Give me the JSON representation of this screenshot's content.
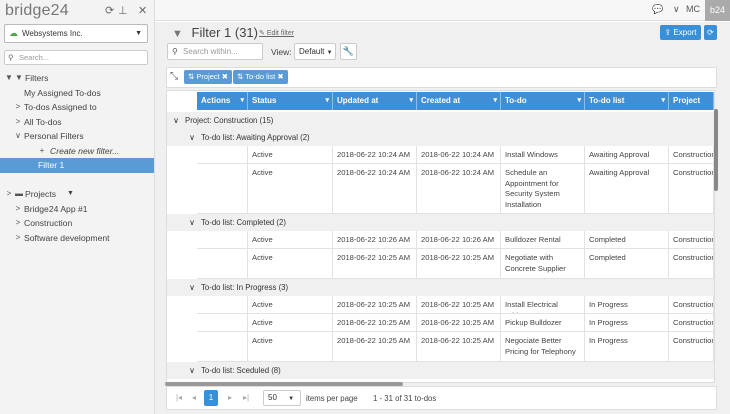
{
  "sidebar": {
    "logo": "bridge24",
    "workspace": "Websystems Inc.",
    "search_placeholder": "Search...",
    "tree": [
      {
        "label": "Filters",
        "toggle": "▼",
        "icon": "▼",
        "level": 0,
        "selected": false
      },
      {
        "label": "My Assigned To-dos",
        "toggle": "",
        "icon": "",
        "level": 1,
        "selected": false
      },
      {
        "label": "To-dos Assigned to",
        "toggle": ">",
        "icon": "",
        "level": 1,
        "selected": false
      },
      {
        "label": "All To-dos",
        "toggle": ">",
        "icon": "",
        "level": 1,
        "selected": false
      },
      {
        "label": "Personal Filters",
        "toggle": "∨",
        "icon": "",
        "level": 1,
        "selected": false
      },
      {
        "label": "Create new filter...",
        "toggle": "",
        "icon": "+",
        "level": 2,
        "selected": false
      },
      {
        "label": "Filter 1",
        "toggle": "",
        "icon": "",
        "level": 2,
        "selected": true
      },
      {
        "label": "",
        "toggle": "",
        "icon": "",
        "level": 0,
        "selected": false
      },
      {
        "label": "Projects",
        "toggle": ">",
        "icon": "▬",
        "level": 0,
        "selected": false
      },
      {
        "label": "Bridge24 App #1",
        "toggle": ">",
        "icon": "",
        "level": 1,
        "selected": false
      },
      {
        "label": "Construction",
        "toggle": ">",
        "icon": "",
        "level": 1,
        "selected": false
      },
      {
        "label": "Software development",
        "toggle": ">",
        "icon": "",
        "level": 1,
        "selected": false
      }
    ]
  },
  "topbar": {
    "user": "MC",
    "badge": "b24"
  },
  "main": {
    "title": "Filter 1",
    "count": "(31)",
    "edit_label": "Edit filter",
    "export_label": "Export",
    "search_placeholder": "Search within...",
    "view_label": "View:",
    "view_value": "Default",
    "chips": [
      "Project",
      "To-do list"
    ]
  },
  "grid": {
    "columns": [
      "Actions",
      "Status",
      "Updated at",
      "Created at",
      "To-do",
      "To-do list",
      "Project"
    ],
    "groups": [
      {
        "level": 0,
        "label": "Project: Construction (15)"
      },
      {
        "level": 1,
        "label": "To-do list: Awaiting Approval (2)"
      },
      {
        "level": 1,
        "label": "To-do list: Completed (2)"
      },
      {
        "level": 1,
        "label": "To-do list: In Progress (3)"
      },
      {
        "level": 1,
        "label": "To-do list: Sceduled (8)"
      }
    ],
    "rows": [
      [
        "",
        "Active",
        "2018-06-22 10:24 AM",
        "2018-06-22 10:24 AM",
        "Install Windows",
        "Awaiting Approval",
        "Construction"
      ],
      [
        "",
        "Active",
        "2018-06-22 10:24 AM",
        "2018-06-22 10:24 AM",
        "Schedule an Appointment for Security System Installation",
        "Awaiting Approval",
        "Construction"
      ],
      [
        "",
        "Active",
        "2018-06-22 10:26 AM",
        "2018-06-22 10:26 AM",
        "Bulldozer Rental",
        "Completed",
        "Construction"
      ],
      [
        "",
        "Active",
        "2018-06-22 10:25 AM",
        "2018-06-22 10:25 AM",
        "Negotiate with Concrete Supplier",
        "Completed",
        "Construction"
      ],
      [
        "",
        "Active",
        "2018-06-22 10:25 AM",
        "2018-06-22 10:25 AM",
        "Install Electrical Wiring",
        "In Progress",
        "Construction"
      ],
      [
        "",
        "Active",
        "2018-06-22 10:25 AM",
        "2018-06-22 10:25 AM",
        "Pickup Bulldozer",
        "In Progress",
        "Construction"
      ],
      [
        "",
        "Active",
        "2018-06-22 10:25 AM",
        "2018-06-22 10:25 AM",
        "Negociate Better Pricing for Telephony",
        "In Progress",
        "Construction"
      ]
    ]
  },
  "pager": {
    "page": "1",
    "page_size": "50",
    "items_label": "items per page",
    "range": "1 - 31 of 31 to-dos"
  }
}
